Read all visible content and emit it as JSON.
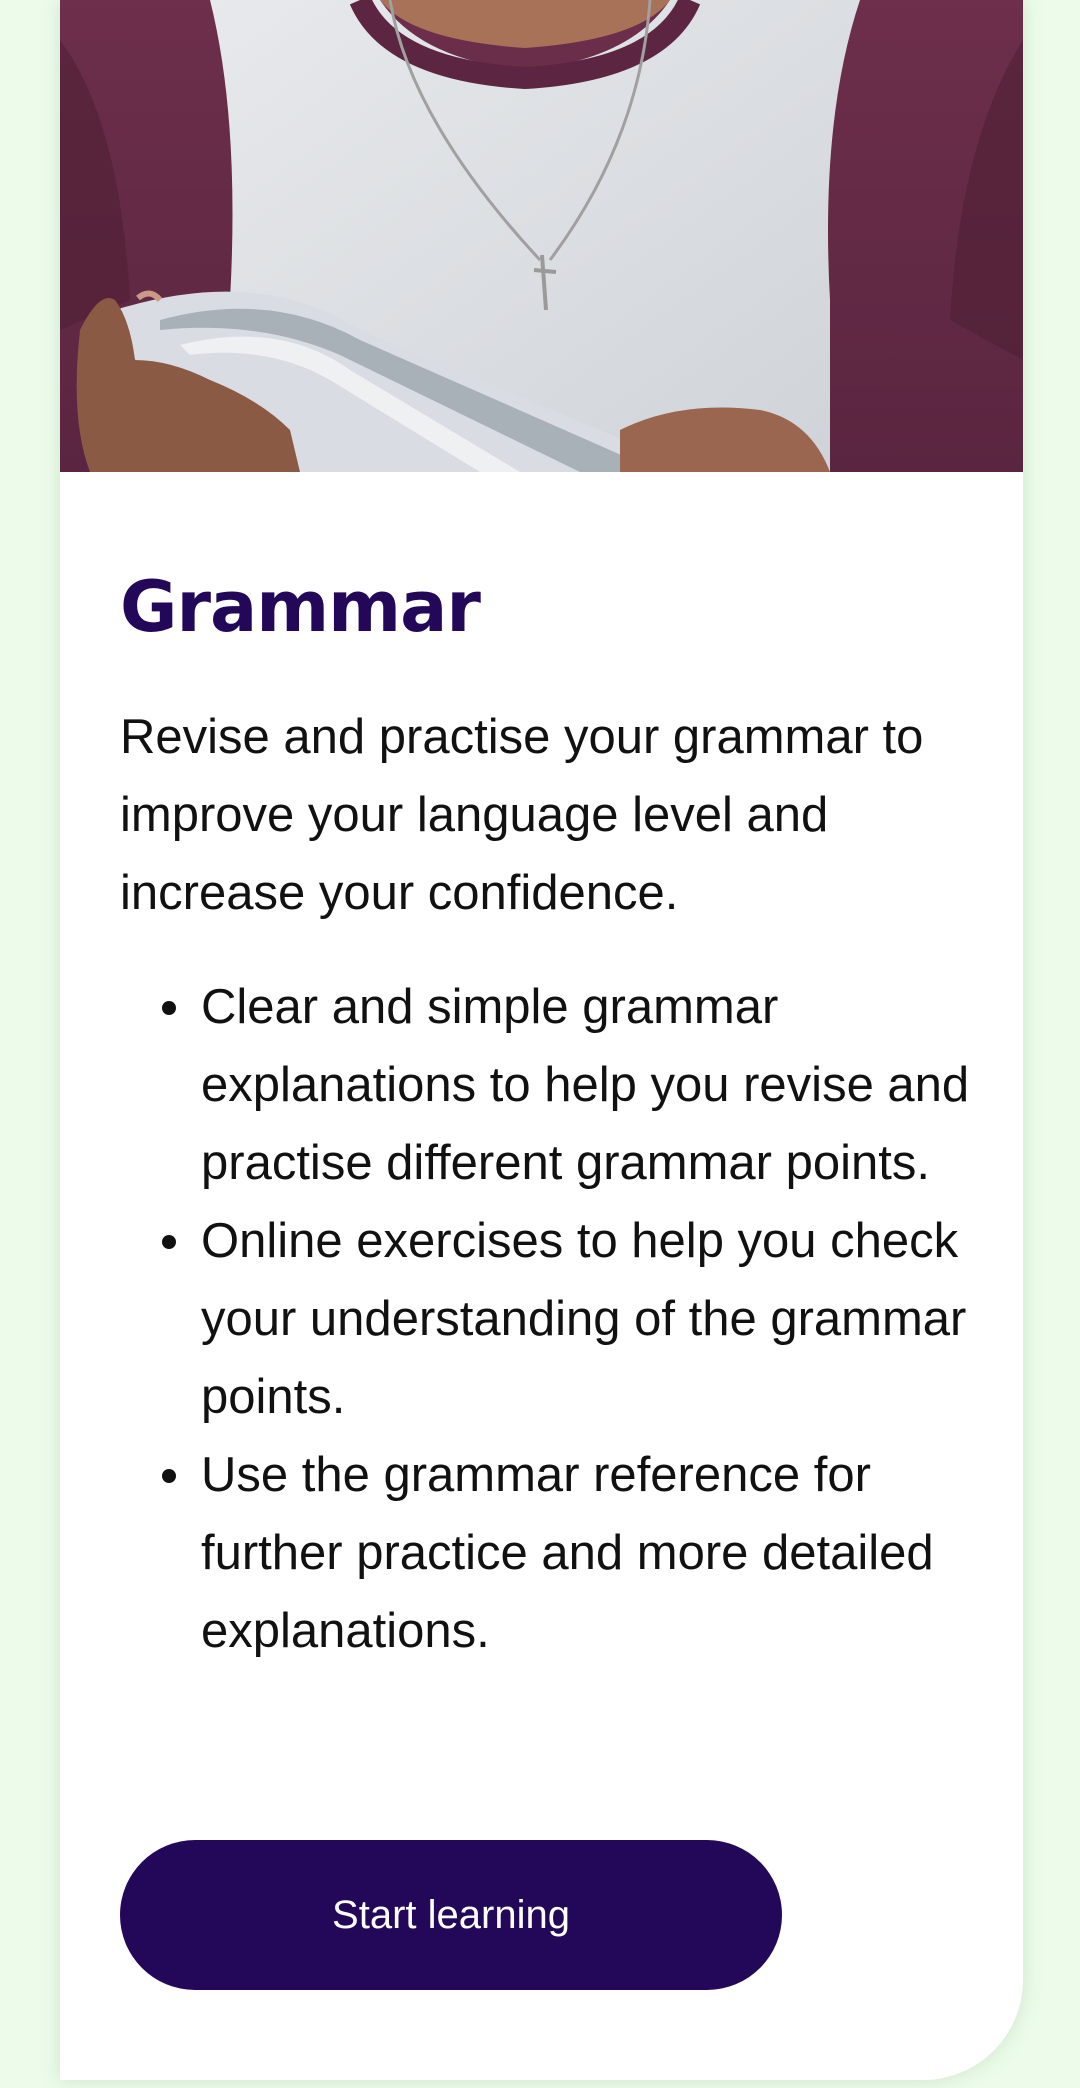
{
  "card": {
    "title": "Grammar",
    "description": "Revise and practise your grammar to improve your language level and increase your confidence.",
    "bullets": [
      "Clear and simple grammar explanations to help you revise and practise different grammar points.",
      "Online exercises to help you check your understanding of the grammar points.",
      "Use the grammar reference for further practice and more detailed explanations."
    ],
    "cta_label": "Start learning"
  },
  "colors": {
    "page_background": "#ecfbea",
    "brand_purple": "#23085a",
    "card_background": "#ffffff",
    "text": "#111111"
  }
}
